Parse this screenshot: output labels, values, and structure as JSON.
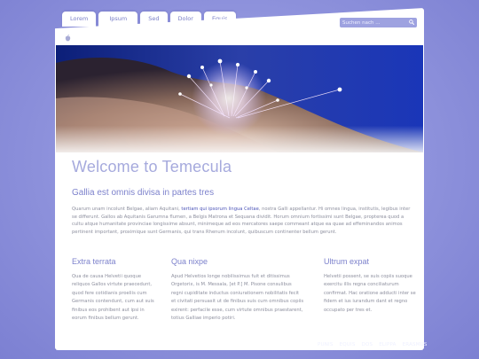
{
  "nav": {
    "tabs": [
      {
        "label": "Lorem"
      },
      {
        "label": "Ipsum"
      },
      {
        "label": "Sed"
      },
      {
        "label": "Dolor"
      },
      {
        "label": "Equis"
      }
    ]
  },
  "search": {
    "placeholder": "Suchen nach ..."
  },
  "main": {
    "title": "Welcome to Temecula",
    "subtitle": "Gallia est omnis divisa in partes tres",
    "intro": {
      "before_link": "Quarum unam incolunt Belgae, aliam Aquitani,",
      "link": "tertiam qui ipsorum lingua Celtae",
      "after_link": ", nostra Galli appellantur. Hi omnes lingua, institutis, legibus inter se differunt. Gallos ab Aquitanis Garumna flumen, a Belgis Matrona et Sequana dividit. Horum omnium fortissimi sunt Belgae, propterea quod a cultu atque humanitate provinciae longissime absunt, minimeque ad eos mercatores saepe commeant atque ea quae ad effeminandos animos pertinent important, proximique sunt Germanis, qui trans Rhenum incolunt, quibuscum continenter bellum gerunt."
    },
    "columns": [
      {
        "title": "Extra terrata",
        "text": "Qua de causa Helvetii quoque reliquos Gallos virtute praecedunt, quod fere cotidianis proeliis cum Germanis contendunt, cum aut suis finibus eos prohibent aut ipsi in eorum finibus bellum gerunt."
      },
      {
        "title": "Qua nixpe",
        "text": "Apud Helvetios longe nobilissimus fuit et ditissimus Orgetorix, is M. Messala, [et P.] M. Pisone consulibus regni cupiditate inductus coniurationem nobilitatis fecit et civitati persuasit ut de finibus suis cum omnibus copiis exirent: perfacile esse, cum virtute omnibus praestarent, totius Galliae imperio potiri."
      },
      {
        "title": "Ultrum expat",
        "text": "Helvetii possent, se suis copiis suoque exercitu illis regna conciliaturum confirmat. Hac oratione adducti inter se fidem et ius iurandum dant et regno occupato per tres et."
      }
    ]
  },
  "footer": {
    "links": [
      {
        "label": "PUNIS"
      },
      {
        "label": "EQUIS"
      },
      {
        "label": "DOS"
      },
      {
        "label": "ELIPPA"
      },
      {
        "label": "ERASMUS"
      }
    ]
  },
  "colors": {
    "background": "#8e92dc",
    "accent": "#7d82cc",
    "title": "#a6aadd",
    "hero_sky": "#2a3fa8",
    "link": "#4c54b8"
  },
  "icons": {
    "search": "magnifier-icon",
    "logo": "apple-icon"
  }
}
